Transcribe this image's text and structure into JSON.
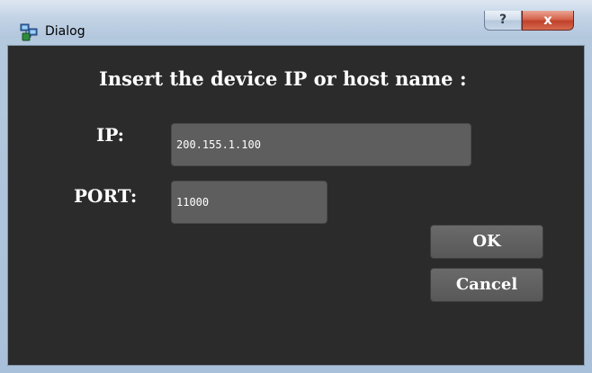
{
  "window": {
    "title": "Dialog",
    "help_label": "?",
    "close_label": "x"
  },
  "dialog": {
    "prompt": "Insert the device IP or host name :",
    "ip_label": "IP:",
    "ip_value": "200.155.1.100",
    "port_label": "PORT:",
    "port_value": "11000",
    "ok_label": "OK",
    "cancel_label": "Cancel"
  },
  "colors": {
    "client_background": "#2b2b2b",
    "input_background": "#5e5e5e",
    "button_background": "#606060",
    "text": "#ffffff",
    "close_button": "#c94b36"
  },
  "icons": {
    "app_icon": "network-devices-icon"
  }
}
